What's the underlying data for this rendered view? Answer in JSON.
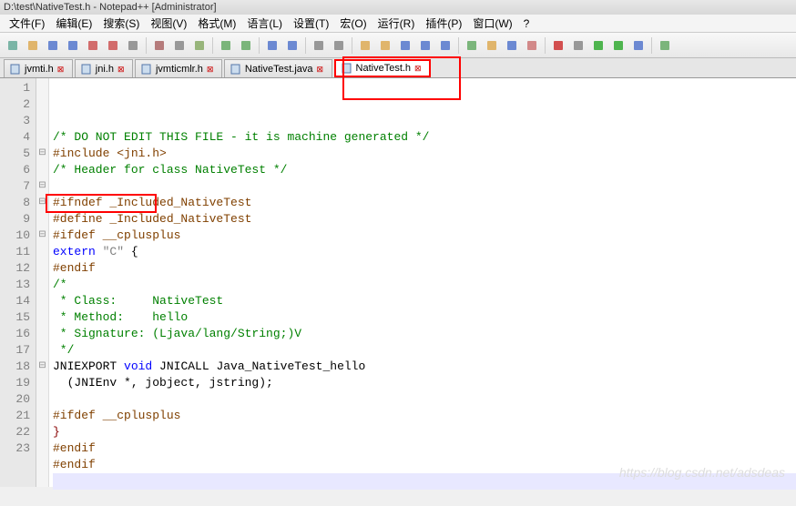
{
  "title": "D:\\test\\NativeTest.h - Notepad++ [Administrator]",
  "menu": {
    "file": "文件(F)",
    "edit": "编辑(E)",
    "search": "搜索(S)",
    "view": "视图(V)",
    "format": "格式(M)",
    "language": "语言(L)",
    "settings": "设置(T)",
    "macro": "宏(O)",
    "run": "运行(R)",
    "plugins": "插件(P)",
    "window": "窗口(W)",
    "help": "?"
  },
  "tabs": [
    {
      "label": "jvmti.h",
      "active": false
    },
    {
      "label": "jni.h",
      "active": false
    },
    {
      "label": "jvmticmlr.h",
      "active": false
    },
    {
      "label": "NativeTest.java",
      "active": false
    },
    {
      "label": "NativeTest.h",
      "active": true
    }
  ],
  "lines": [
    {
      "n": 1,
      "fold": "",
      "cls": "c-comment",
      "text": "/* DO NOT EDIT THIS FILE - it is machine generated */"
    },
    {
      "n": 2,
      "fold": "",
      "cls": "c-pre",
      "text": "#include <jni.h>"
    },
    {
      "n": 3,
      "fold": "",
      "cls": "c-comment",
      "text": "/* Header for class NativeTest */"
    },
    {
      "n": 4,
      "fold": "",
      "cls": "",
      "text": ""
    },
    {
      "n": 5,
      "fold": "⊟",
      "cls": "c-pre",
      "text": "#ifndef _Included_NativeTest"
    },
    {
      "n": 6,
      "fold": "",
      "cls": "c-pre",
      "text": "#define _Included_NativeTest"
    },
    {
      "n": 7,
      "fold": "⊟",
      "cls": "c-pre",
      "text": "#ifdef __cplusplus"
    },
    {
      "n": 8,
      "fold": "⊟",
      "cls": "",
      "text": "extern \"C\" {"
    },
    {
      "n": 9,
      "fold": "",
      "cls": "c-pre",
      "text": "#endif"
    },
    {
      "n": 10,
      "fold": "⊟",
      "cls": "c-comment",
      "text": "/*"
    },
    {
      "n": 11,
      "fold": "",
      "cls": "c-comment",
      "text": " * Class:     NativeTest"
    },
    {
      "n": 12,
      "fold": "",
      "cls": "c-comment",
      "text": " * Method:    hello"
    },
    {
      "n": 13,
      "fold": "",
      "cls": "c-comment",
      "text": " * Signature: (Ljava/lang/String;)V"
    },
    {
      "n": 14,
      "fold": "",
      "cls": "c-comment",
      "text": " */"
    },
    {
      "n": 15,
      "fold": "",
      "cls": "",
      "text": "JNIEXPORT void JNICALL Java_NativeTest_hello"
    },
    {
      "n": 16,
      "fold": "",
      "cls": "",
      "text": "  (JNIEnv *, jobject, jstring);"
    },
    {
      "n": 17,
      "fold": "",
      "cls": "",
      "text": ""
    },
    {
      "n": 18,
      "fold": "⊟",
      "cls": "c-pre",
      "text": "#ifdef __cplusplus"
    },
    {
      "n": 19,
      "fold": "",
      "cls": "",
      "text": "}"
    },
    {
      "n": 20,
      "fold": "",
      "cls": "c-pre",
      "text": "#endif"
    },
    {
      "n": 21,
      "fold": "",
      "cls": "c-pre",
      "text": "#endif"
    },
    {
      "n": 22,
      "fold": "",
      "cls": "highlight-line",
      "text": " "
    },
    {
      "n": 23,
      "fold": "",
      "cls": "",
      "text": ""
    }
  ],
  "watermark": "https://blog.csdn.net/adsdeas",
  "toolbar_icons": [
    {
      "name": "new-file-icon",
      "color": "#6a9"
    },
    {
      "name": "open-file-icon",
      "color": "#da5"
    },
    {
      "name": "save-icon",
      "color": "#57c"
    },
    {
      "name": "save-all-icon",
      "color": "#57c"
    },
    {
      "name": "close-icon",
      "color": "#c55"
    },
    {
      "name": "close-all-icon",
      "color": "#c55"
    },
    {
      "name": "print-icon",
      "color": "#888"
    },
    {
      "name": "sep"
    },
    {
      "name": "cut-icon",
      "color": "#a66"
    },
    {
      "name": "copy-icon",
      "color": "#888"
    },
    {
      "name": "paste-icon",
      "color": "#8a6"
    },
    {
      "name": "sep"
    },
    {
      "name": "undo-icon",
      "color": "#6a6"
    },
    {
      "name": "redo-icon",
      "color": "#6a6"
    },
    {
      "name": "sep"
    },
    {
      "name": "find-icon",
      "color": "#57c"
    },
    {
      "name": "replace-icon",
      "color": "#57c"
    },
    {
      "name": "sep"
    },
    {
      "name": "zoom-in-icon",
      "color": "#888"
    },
    {
      "name": "zoom-out-icon",
      "color": "#888"
    },
    {
      "name": "sep"
    },
    {
      "name": "sync-v-icon",
      "color": "#da5"
    },
    {
      "name": "sync-h-icon",
      "color": "#da5"
    },
    {
      "name": "wrap-icon",
      "color": "#57c"
    },
    {
      "name": "all-chars-icon",
      "color": "#57c"
    },
    {
      "name": "indent-guide-icon",
      "color": "#57c"
    },
    {
      "name": "sep"
    },
    {
      "name": "lang-icon",
      "color": "#6a6"
    },
    {
      "name": "doc-map-icon",
      "color": "#da5"
    },
    {
      "name": "func-list-icon",
      "color": "#57c"
    },
    {
      "name": "folder-icon",
      "color": "#c77"
    },
    {
      "name": "sep"
    },
    {
      "name": "record-icon",
      "color": "#c33"
    },
    {
      "name": "stop-icon",
      "color": "#888"
    },
    {
      "name": "play-icon",
      "color": "#3a3"
    },
    {
      "name": "replay-icon",
      "color": "#3a3"
    },
    {
      "name": "save-macro-icon",
      "color": "#57c"
    },
    {
      "name": "sep"
    },
    {
      "name": "spell-icon",
      "color": "#6a6"
    }
  ]
}
